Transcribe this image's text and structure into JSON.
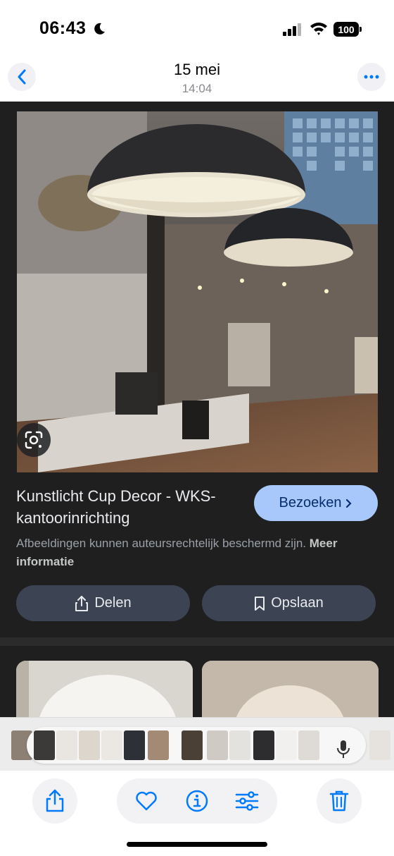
{
  "status_bar": {
    "time": "06:43",
    "battery": "100"
  },
  "header": {
    "date": "15 mei",
    "time": "14:04"
  },
  "result": {
    "title": "Kunstlicht Cup Decor - WKS-kantoorinrichting",
    "visit_label": "Bezoeken",
    "copyright_text": "Afbeeldingen kunnen auteursrechtelijk beschermd zijn.",
    "more_info_link": "Meer informatie",
    "share_label": "Delen",
    "save_label": "Opslaan"
  },
  "icons": {
    "status": [
      "moon-icon",
      "signal-icon",
      "wifi-icon",
      "battery-icon"
    ],
    "header": [
      "chevron-left-icon",
      "more-icon"
    ],
    "toolbar": [
      "share-icon",
      "heart-icon",
      "info-icon",
      "sliders-icon",
      "trash-icon"
    ],
    "other": [
      "lens-icon",
      "chevron-right-icon",
      "bookmark-icon",
      "mic-icon"
    ]
  },
  "colors": {
    "accent_blue": "#007aff",
    "visit_button": "#a8c7fa",
    "dark_background": "#1f1f1f",
    "action_button": "#3c4454"
  }
}
